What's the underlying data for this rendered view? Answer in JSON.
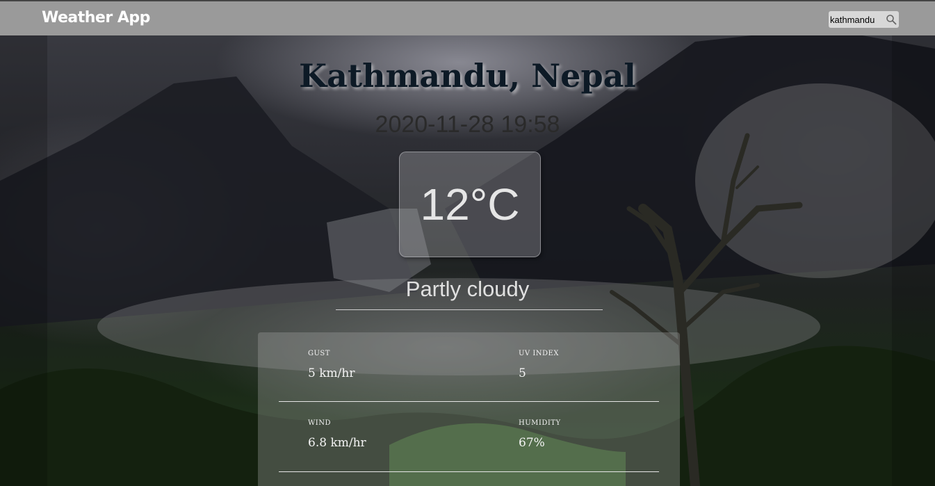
{
  "header": {
    "brand": "Weather App",
    "search": {
      "value": "kathmandu",
      "icon": "search-icon"
    }
  },
  "location": {
    "city": "Kathmandu, Nepal",
    "datetime": "2020-11-28 19:58"
  },
  "current": {
    "temperature": "12°C",
    "condition": "Partly cloudy"
  },
  "details": [
    {
      "label": "GUST",
      "value": "5 km/hr"
    },
    {
      "label": "UV INDEX",
      "value": "5"
    },
    {
      "label": "WIND",
      "value": "6.8 km/hr"
    },
    {
      "label": "HUMIDITY",
      "value": "67%"
    }
  ],
  "colors": {
    "topbar": "#9a9a9a",
    "city_text": "#0d1a26"
  }
}
